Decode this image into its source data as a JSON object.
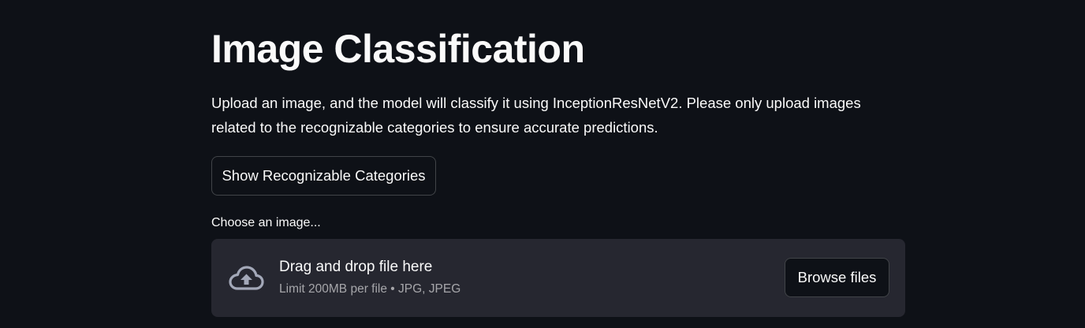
{
  "header": {
    "title": "Image Classification",
    "description": "Upload an image, and the model will classify it using InceptionResNetV2. Please only upload images related to the recognizable categories to ensure accurate predictions."
  },
  "categories_button": {
    "label": "Show Recognizable Categories"
  },
  "uploader": {
    "label": "Choose an image...",
    "drop_text": "Drag and drop file here",
    "limit_text": "Limit 200MB per file • JPG, JPEG",
    "browse_label": "Browse files",
    "icon": "cloud-upload-icon"
  },
  "colors": {
    "background": "#0e1117",
    "dropzone": "#262730",
    "text": "#fafafa",
    "icon": "#a3a8b8"
  }
}
